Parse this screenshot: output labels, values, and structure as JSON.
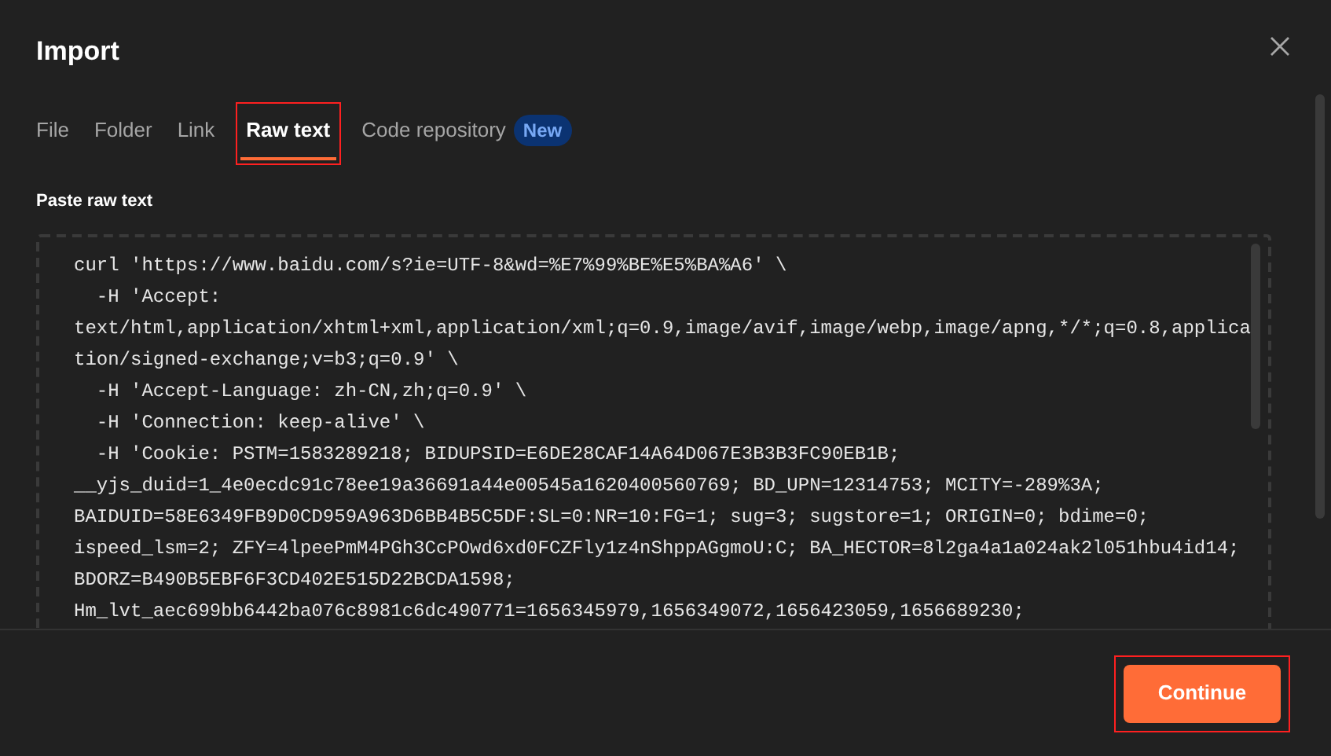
{
  "dialog": {
    "title": "Import"
  },
  "tabs": [
    {
      "label": "File",
      "selected": false
    },
    {
      "label": "Folder",
      "selected": false
    },
    {
      "label": "Link",
      "selected": false
    },
    {
      "label": "Raw text",
      "selected": true
    },
    {
      "label": "Code repository",
      "selected": false,
      "badge": "New"
    }
  ],
  "raw_text": {
    "label": "Paste raw text",
    "lines": [
      "curl 'https://www.baidu.com/s?ie=UTF-8&wd=%E7%99%BE%E5%BA%A6' \\",
      "  -H 'Accept:",
      "text/html,application/xhtml+xml,application/xml;q=0.9,image/avif,image/webp,image/apng,*/*;q=0.8,applica",
      "tion/signed-exchange;v=b3;q=0.9' \\",
      "  -H 'Accept-Language: zh-CN,zh;q=0.9' \\",
      "  -H 'Connection: keep-alive' \\",
      "  -H 'Cookie: PSTM=1583289218; BIDUPSID=E6DE28CAF14A64D067E3B3B3FC90EB1B;",
      "__yjs_duid=1_4e0ecdc91c78ee19a36691a44e00545a1620400560769; BD_UPN=12314753; MCITY=-289%3A;",
      "BAIDUID=58E6349FB9D0CD959A963D6BB4B5C5DF:SL=0:NR=10:FG=1; sug=3; sugstore=1; ORIGIN=0; bdime=0;",
      "ispeed_lsm=2; ZFY=4lpeePmM4PGh3CcPOwd6xd0FCZFly1z4nShppAGgmoU:C; BA_HECTOR=8l2ga4a1a024ak2l051hbu4id14;",
      "BDORZ=B490B5EBF6F3CD402E515D22BCDA1598;",
      "Hm_lvt_aec699bb6442ba076c8981c6dc490771=1656345979,1656349072,1656423059,1656689230;"
    ]
  },
  "footer": {
    "button": "Continue"
  }
}
